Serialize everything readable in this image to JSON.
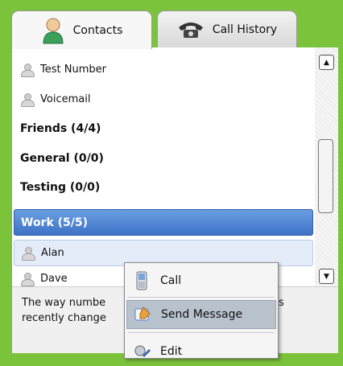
{
  "tabs": [
    {
      "label": "Contacts",
      "icon": "contact-person-icon",
      "active": true
    },
    {
      "label": "Call History",
      "icon": "telephone-icon",
      "active": false
    }
  ],
  "contacts_top": [
    {
      "name": "Test Number"
    },
    {
      "name": "Voicemail"
    }
  ],
  "groups": [
    {
      "label": "Friends (4/4)"
    },
    {
      "label": "General (0/0)"
    },
    {
      "label": "Testing (0/0)"
    },
    {
      "label": "Work (5/5)"
    }
  ],
  "work_contacts": [
    {
      "name": "Alan"
    },
    {
      "name": "Dave"
    }
  ],
  "notice": {
    "line1_left": "The way numbe",
    "line1_right": "s",
    "line2": "recently change"
  },
  "context_menu": {
    "items": [
      {
        "label": "Call",
        "icon": "mobile-phone-icon"
      },
      {
        "label": "Send Message",
        "icon": "message-icon"
      },
      {
        "label": "Edit",
        "icon": "edit-icon"
      }
    ]
  },
  "colors": {
    "window_background": "#7cc33c",
    "selected_group": "#4a80d0",
    "menu_highlight": "#b8c2cd"
  }
}
